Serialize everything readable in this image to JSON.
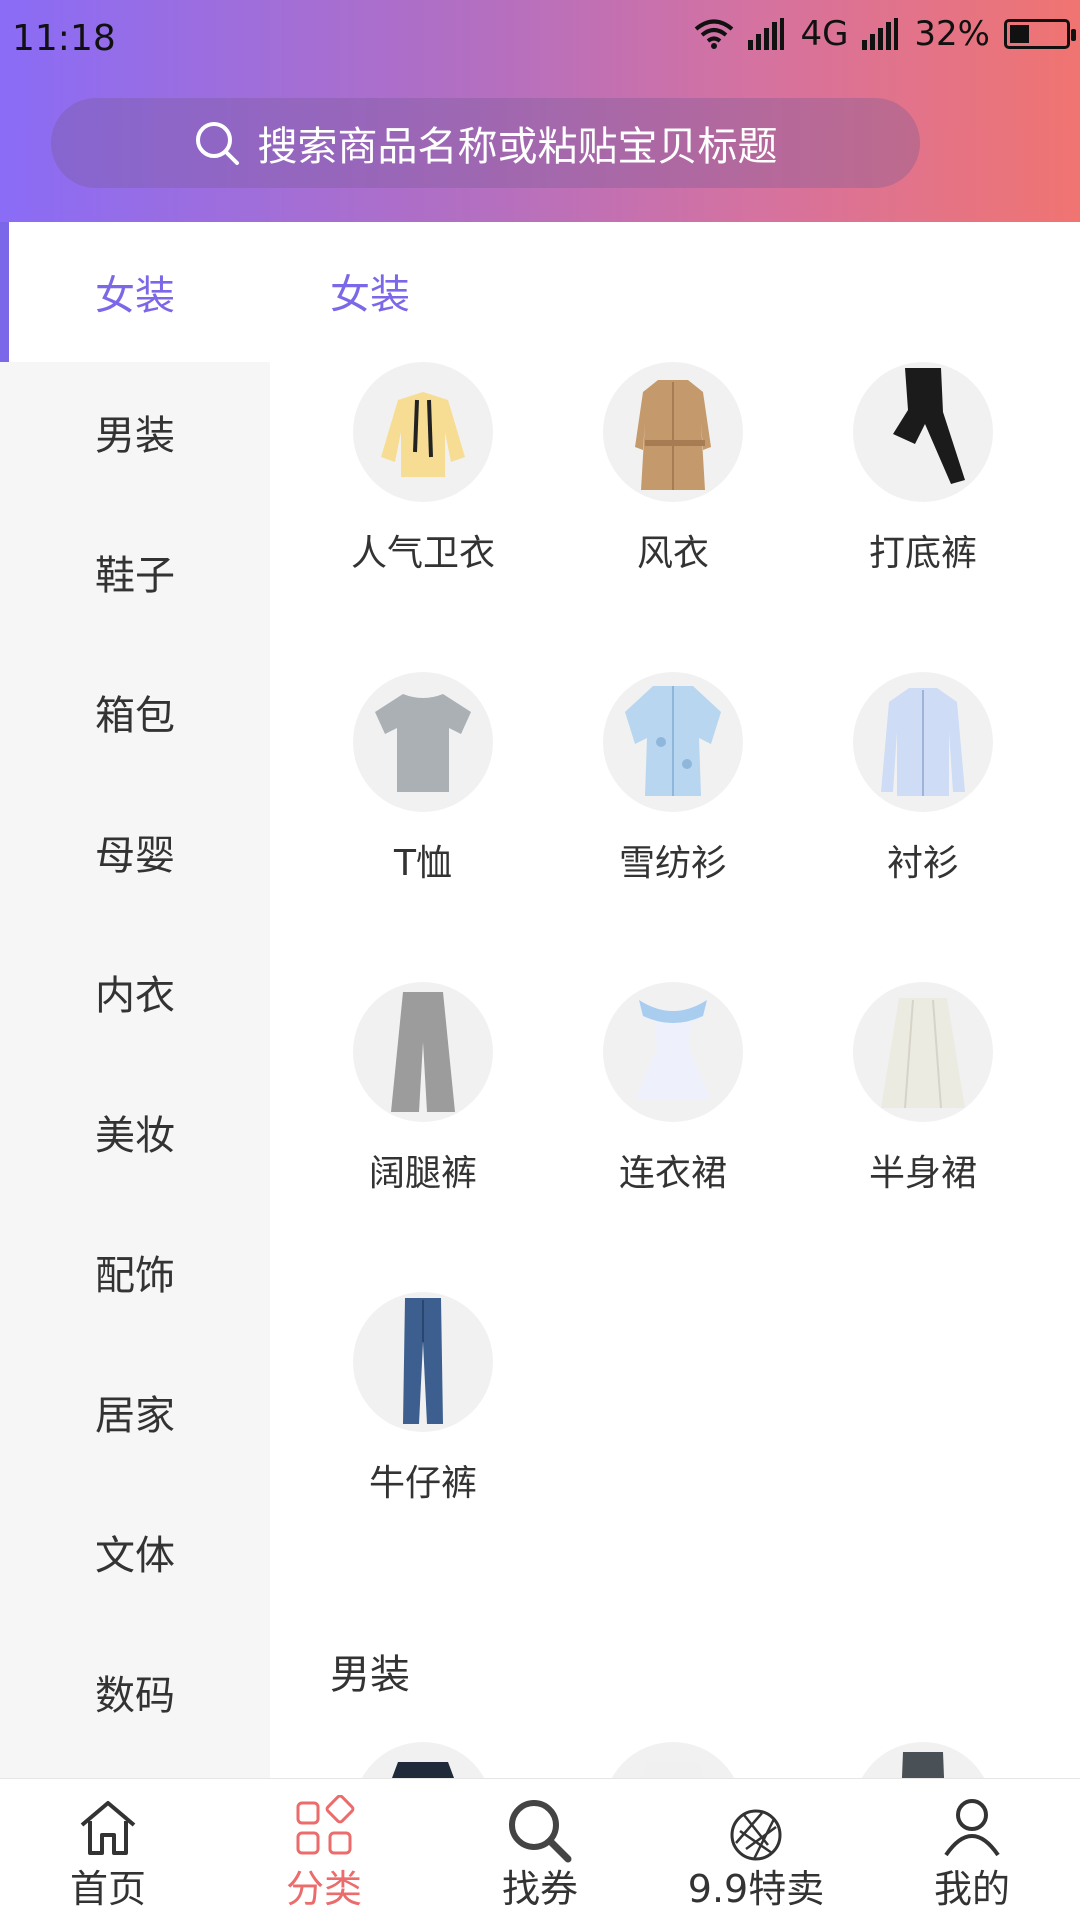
{
  "status": {
    "time": "11:18",
    "network": "4G",
    "battery": "32%"
  },
  "search": {
    "placeholder": "搜索商品名称或粘贴宝贝标题",
    "icon": "search-icon"
  },
  "sidebar": {
    "items": [
      {
        "label": "女装",
        "active": true
      },
      {
        "label": "男装"
      },
      {
        "label": "鞋子"
      },
      {
        "label": "箱包"
      },
      {
        "label": "母婴"
      },
      {
        "label": "内衣"
      },
      {
        "label": "美妆"
      },
      {
        "label": "配饰"
      },
      {
        "label": "居家"
      },
      {
        "label": "文体"
      },
      {
        "label": "数码"
      }
    ]
  },
  "content": {
    "section1": {
      "title": "女装",
      "items": [
        {
          "label": "人气卫衣",
          "icon": "hoodie-icon"
        },
        {
          "label": "风衣",
          "icon": "trench-coat-icon"
        },
        {
          "label": "打底裤",
          "icon": "leggings-icon"
        },
        {
          "label": "T恤",
          "icon": "tshirt-icon"
        },
        {
          "label": "雪纺衫",
          "icon": "chiffon-shirt-icon"
        },
        {
          "label": "衬衫",
          "icon": "shirt-icon"
        },
        {
          "label": "阔腿裤",
          "icon": "wide-leg-pants-icon"
        },
        {
          "label": "连衣裙",
          "icon": "dress-icon"
        },
        {
          "label": "半身裙",
          "icon": "skirt-icon"
        },
        {
          "label": "牛仔裤",
          "icon": "jeans-icon"
        }
      ]
    },
    "section2": {
      "title": "男装"
    }
  },
  "bottom_nav": [
    {
      "label": "首页",
      "icon": "home-icon"
    },
    {
      "label": "分类",
      "icon": "category-icon",
      "active": true
    },
    {
      "label": "找券",
      "icon": "search-coupon-icon"
    },
    {
      "label": "9.9特卖",
      "icon": "aperture-icon"
    },
    {
      "label": "我的",
      "icon": "user-icon"
    }
  ],
  "colors": {
    "accent": "#7b68e8",
    "nav_active": "#ec6b6b",
    "gradient_start": "#8a6cf6",
    "gradient_end": "#f07471"
  }
}
